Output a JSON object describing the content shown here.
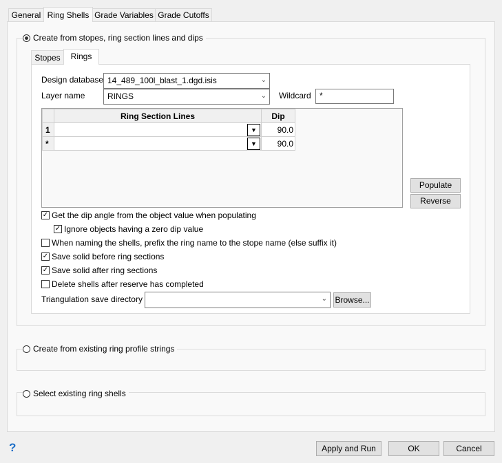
{
  "tabs": [
    "General",
    "Ring Shells",
    "Grade Variables",
    "Grade Cutoffs"
  ],
  "group1": {
    "label": "Create from stopes, ring section lines and dips",
    "selected": true,
    "subtabs": [
      "Stopes",
      "Rings"
    ],
    "design_database_label": "Design database",
    "design_database_value": "14_489_100l_blast_1.dgd.isis",
    "layer_name_label": "Layer name",
    "layer_name_value": "RINGS",
    "wildcard_label": "Wildcard",
    "wildcard_value": "*",
    "table": {
      "headers": [
        "Ring Section Lines",
        "Dip"
      ],
      "rows": [
        {
          "num": "1",
          "line": "",
          "dip": "90.0"
        },
        {
          "num": "*",
          "line": "",
          "dip": "90.0"
        }
      ]
    },
    "populate": "Populate",
    "reverse": "Reverse",
    "checks": [
      {
        "label": "Get the dip angle from the object value when populating",
        "checked": true
      },
      {
        "label": "Ignore objects having a zero dip value",
        "checked": true
      },
      {
        "label": "When naming the shells, prefix the ring name to the stope name (else suffix it)",
        "checked": false
      },
      {
        "label": "Save solid before ring sections",
        "checked": true
      },
      {
        "label": "Save solid after ring sections",
        "checked": true
      },
      {
        "label": "Delete shells after reserve has completed",
        "checked": false
      }
    ],
    "tri_label": "Triangulation save directory",
    "tri_value": "",
    "browse": "Browse..."
  },
  "group2": {
    "label": "Create from existing ring profile strings"
  },
  "group3": {
    "label": "Select existing ring shells"
  },
  "footer": {
    "help": "?",
    "apply": "Apply and Run",
    "ok": "OK",
    "cancel": "Cancel"
  }
}
